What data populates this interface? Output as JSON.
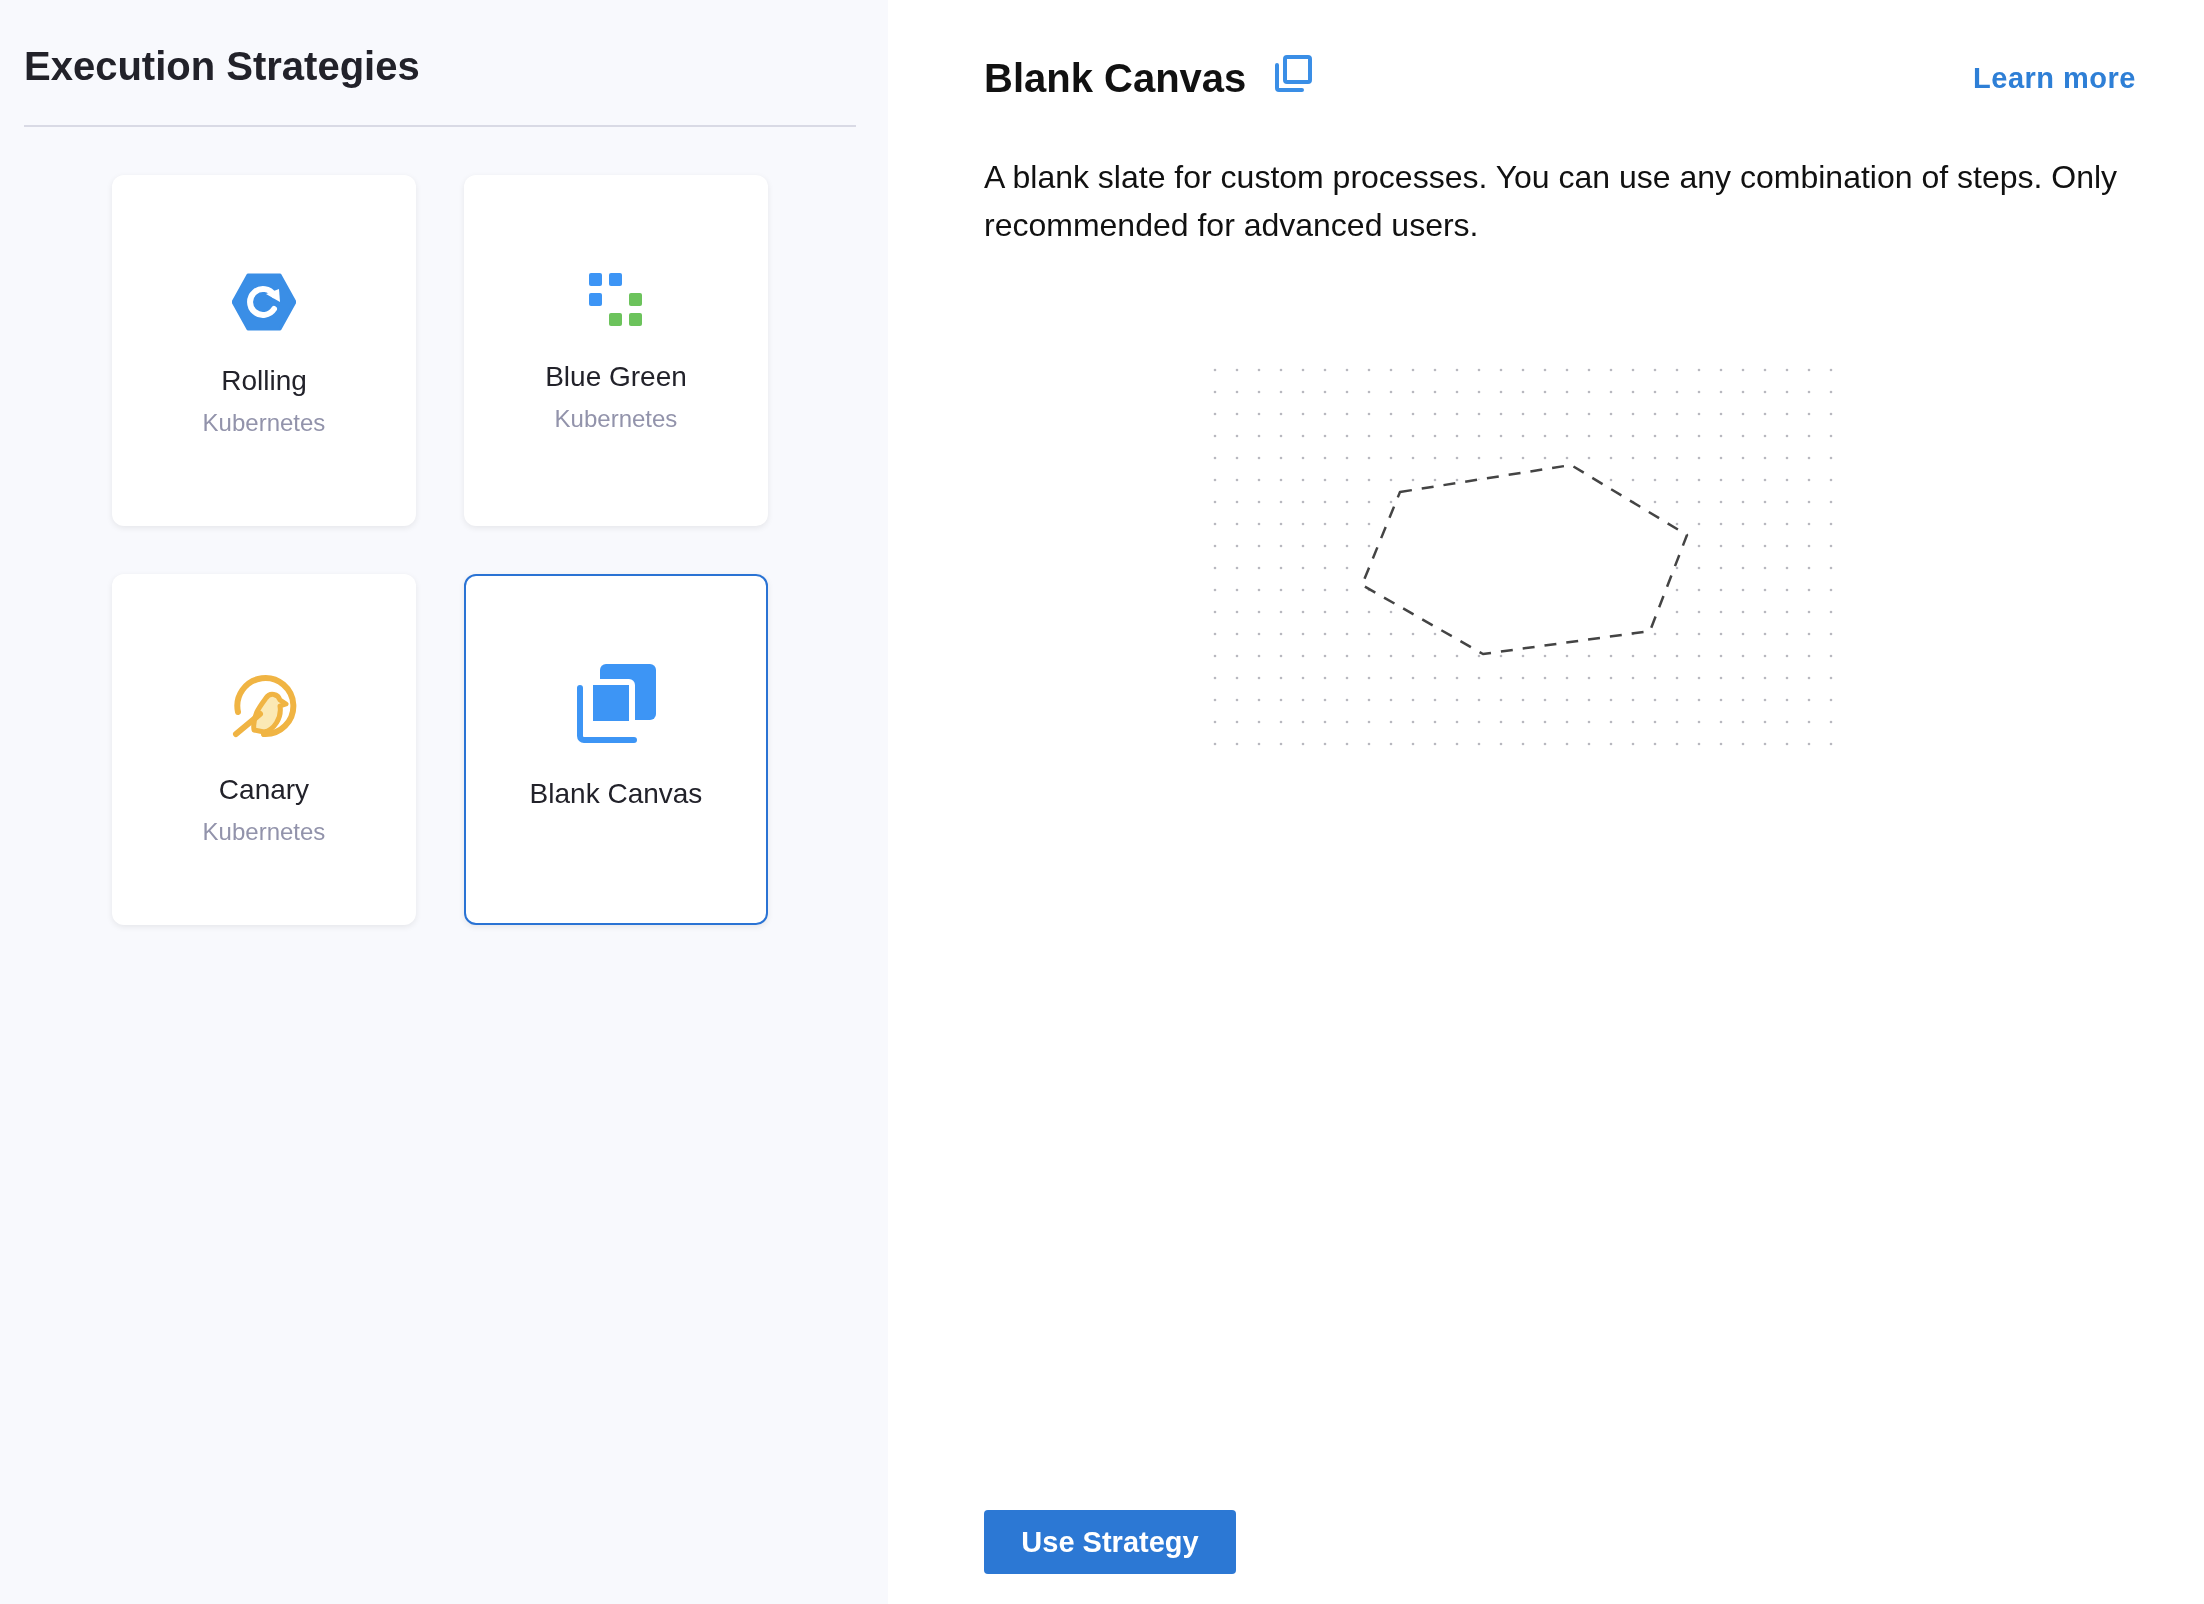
{
  "sidebar": {
    "title": "Execution Strategies",
    "strategies": [
      {
        "kind": "rolling",
        "name": "Rolling",
        "platform": "Kubernetes",
        "selected": false
      },
      {
        "kind": "bluegreen",
        "name": "Blue Green",
        "platform": "Kubernetes",
        "selected": false
      },
      {
        "kind": "canary",
        "name": "Canary",
        "platform": "Kubernetes",
        "selected": false
      },
      {
        "kind": "blank",
        "name": "Blank Canvas",
        "selected": true
      }
    ]
  },
  "detail": {
    "title": "Blank Canvas",
    "link": "Learn more",
    "description": "A blank slate for custom processes. You can use any combination of steps. Only recommended for advanced users.",
    "button": "Use Strategy"
  }
}
